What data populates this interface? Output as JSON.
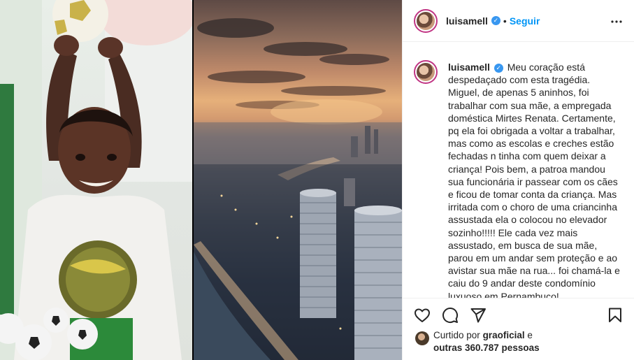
{
  "post": {
    "username": "luisamell",
    "follow_label": "Seguir",
    "separator": "•",
    "caption_username": "luisamell",
    "caption": "Meu coração está despedaçado com esta tragédia. Miguel, de apenas 5 aninhos, foi trabalhar com sua mãe, a empregada doméstica Mirtes Renata. Certamente, pq ela foi obrigada a voltar a trabalhar, mas como as escolas e creches estão fechadas n tinha com quem deixar a criança! Pois bem, a patroa mandou sua funcionária ir passear com os cães e ficou de tomar conta da criança. Mas irritada com o choro de uma criancinha assustada ela o colocou no elevador sozinho!!!!! Ele cada vez mais assustado, em busca de sua mãe, parou em um andar sem proteção e ao avistar sua mãe na rua... foi chamá-la e caiu do 9 andar deste condomínio luxuoso em Pernambuco!"
  },
  "likes": {
    "prefix": "Curtido por",
    "liker": "graoficial",
    "conjunction": "e",
    "others": "outras 360.787 pessoas"
  },
  "icons": {
    "verified": "verified-badge-icon",
    "more": "more-options-icon",
    "like": "heart-icon",
    "comment": "comment-icon",
    "share": "share-icon",
    "save": "bookmark-icon"
  },
  "colors": {
    "accent": "#0095f6",
    "verified": "#3897f0",
    "text": "#262626",
    "border": "#efefef"
  }
}
